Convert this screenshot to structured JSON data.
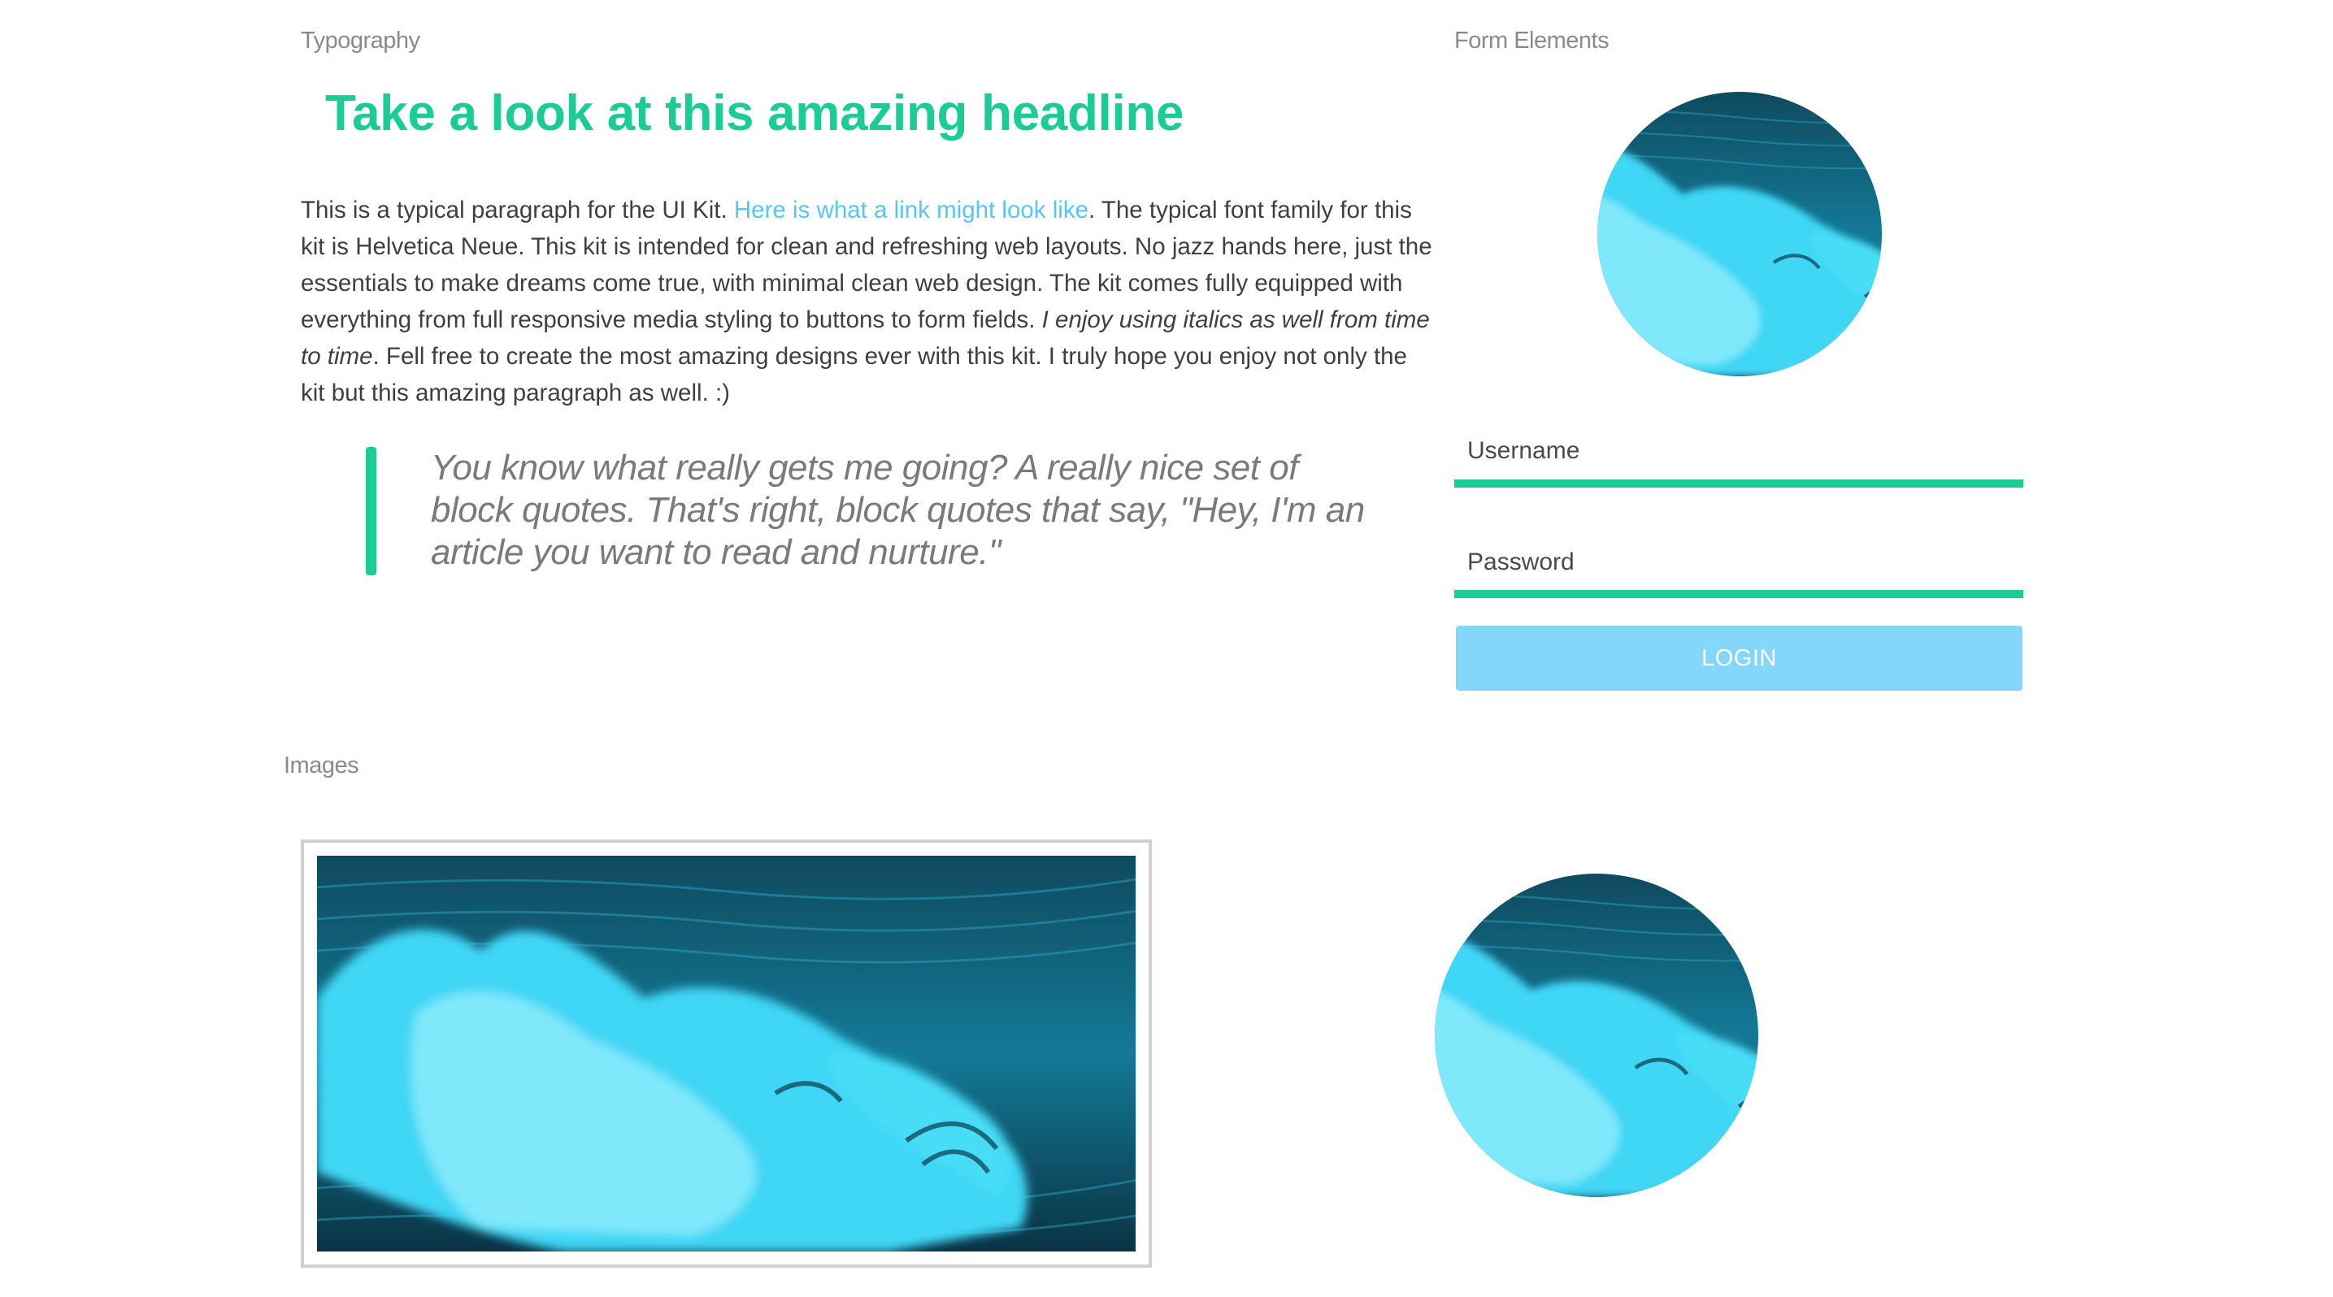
{
  "sections": {
    "typography": "Typography",
    "form_elements": "Form Elements",
    "images": "Images"
  },
  "typography": {
    "headline": "Take a look at this amazing headline",
    "paragraph": {
      "intro": "This is a typical paragraph for the UI Kit. ",
      "link": "Here is what a link might look like",
      "middle": ". The typical font family for this kit is Helvetica Neue. This kit is intended for clean and refreshing web layouts. No jazz hands here, just the essentials to make dreams come true, with minimal clean web design. The kit comes fully equipped with everything from full responsive media styling to buttons to form fields. ",
      "italic": "I enjoy using italics as well from time to time",
      "end": ". Fell free to create the most amazing designs ever with this kit. I truly hope you enjoy not only the kit but this amazing paragraph as well. :)"
    },
    "blockquote": "You know what really gets me going? A really nice set of block quotes. That's right, block quotes that say, \"Hey, I'm an article you want to read and nurture.\""
  },
  "form": {
    "username_label": "Username",
    "password_label": "Password",
    "login_label": "LOGIN"
  },
  "colors": {
    "accent_green": "#1ccb95",
    "link_blue": "#58c6f0",
    "button_blue": "#84d6fb",
    "image_cyan": "#3fd6f5",
    "image_dark": "#0c3a4d"
  }
}
